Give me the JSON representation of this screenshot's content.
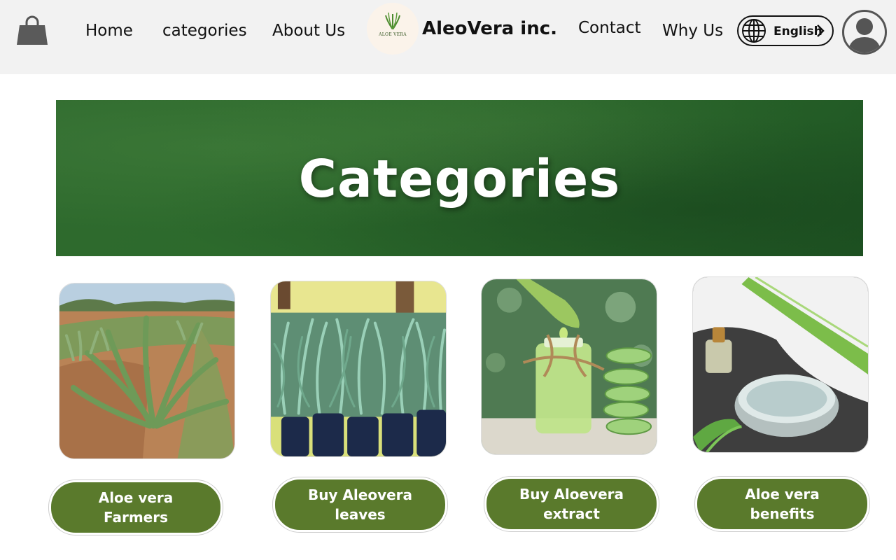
{
  "header": {
    "nav": {
      "home": "Home",
      "categories": "categories",
      "about": "About Us",
      "contact": "Contact",
      "why": "Why Us"
    },
    "logo_text": "ALOE VERA",
    "brand": "AleoVera inc.",
    "language": "English"
  },
  "hero": {
    "title": "Categories"
  },
  "categories": [
    {
      "label": "Aloe vera\nFarmers"
    },
    {
      "label": "Buy Aleovera\nleaves"
    },
    {
      "label": "Buy Aloevera\nextract"
    },
    {
      "label": "Aloe vera\nbenefits"
    }
  ],
  "colors": {
    "accent_green": "#5a7a2c",
    "hero_green": "#2c6a2c",
    "header_bg": "#f2f2f2"
  },
  "icons": {
    "cart": "shopping-bag-icon",
    "language": "globe-icon",
    "chevron": "chevron-right-icon",
    "profile": "user-avatar-icon"
  }
}
